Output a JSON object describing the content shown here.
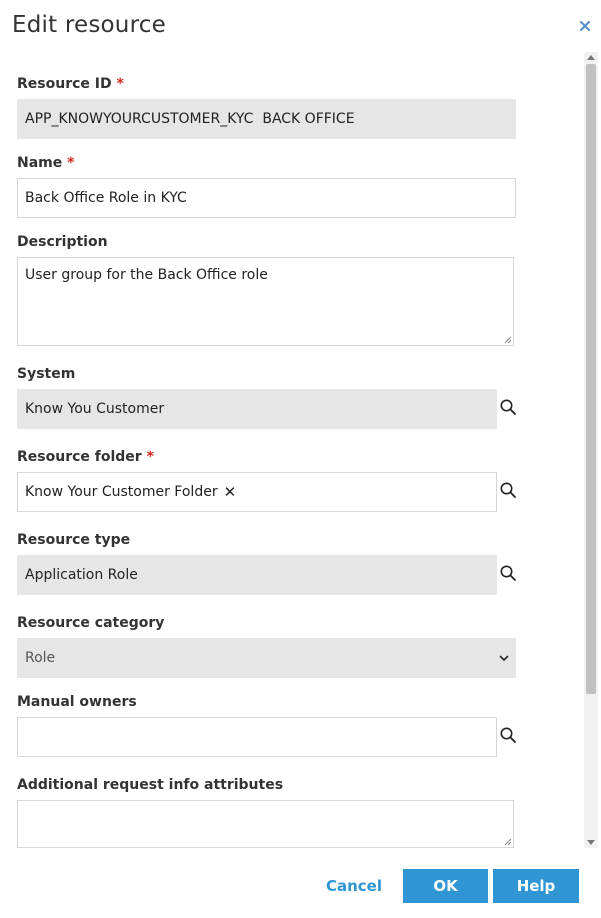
{
  "dialog": {
    "title": "Edit resource"
  },
  "fields": {
    "resource_id": {
      "label": "Resource ID",
      "required_mark": "*",
      "value": "APP_KNOWYOURCUSTOMER_KYC  BACK OFFICE"
    },
    "name": {
      "label": "Name",
      "required_mark": "*",
      "value": "Back Office Role in KYC"
    },
    "description": {
      "label": "Description",
      "value": "User group for the Back Office role"
    },
    "system": {
      "label": "System",
      "value": "Know You Customer"
    },
    "resource_folder": {
      "label": "Resource folder",
      "required_mark": "*",
      "value": "Know Your Customer Folder",
      "remove_glyph": "✕"
    },
    "resource_type": {
      "label": "Resource type",
      "value": "Application Role"
    },
    "resource_category": {
      "label": "Resource category",
      "value": "Role"
    },
    "manual_owners": {
      "label": "Manual owners",
      "value": ""
    },
    "additional_request_info": {
      "label": "Additional request info attributes",
      "value": ""
    }
  },
  "footer": {
    "cancel_label": "Cancel",
    "ok_label": "OK",
    "help_label": "Help"
  },
  "colors": {
    "accent": "#2f96d3",
    "required": "#d9261c",
    "readonly_bg": "#e6e6e6"
  },
  "icons": {
    "close": "close-icon",
    "lookup": "search-icon",
    "remove": "remove-icon",
    "dropdown": "chevron-down-icon"
  }
}
